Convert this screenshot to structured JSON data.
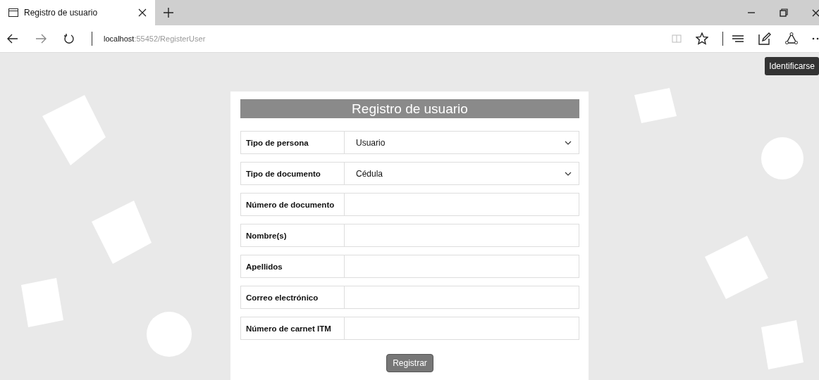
{
  "browser": {
    "tab_title": "Registro de usuario",
    "address": {
      "host": "localhost",
      "path": ":55452/RegisterUser"
    }
  },
  "page": {
    "login_button": "Identificarse",
    "form": {
      "title": "Registro de usuario",
      "fields": [
        {
          "kind": "select",
          "label": "Tipo de persona",
          "value": "Usuario"
        },
        {
          "kind": "select",
          "label": "Tipo de documento",
          "value": "Cédula"
        },
        {
          "kind": "text",
          "label": "Número de documento"
        },
        {
          "kind": "text",
          "label": "Nombre(s)"
        },
        {
          "kind": "text",
          "label": "Apellidos"
        },
        {
          "kind": "text",
          "label": "Correo electrónico"
        },
        {
          "kind": "text",
          "label": "Número de carnet ITM"
        }
      ],
      "submit": "Registrar"
    }
  }
}
